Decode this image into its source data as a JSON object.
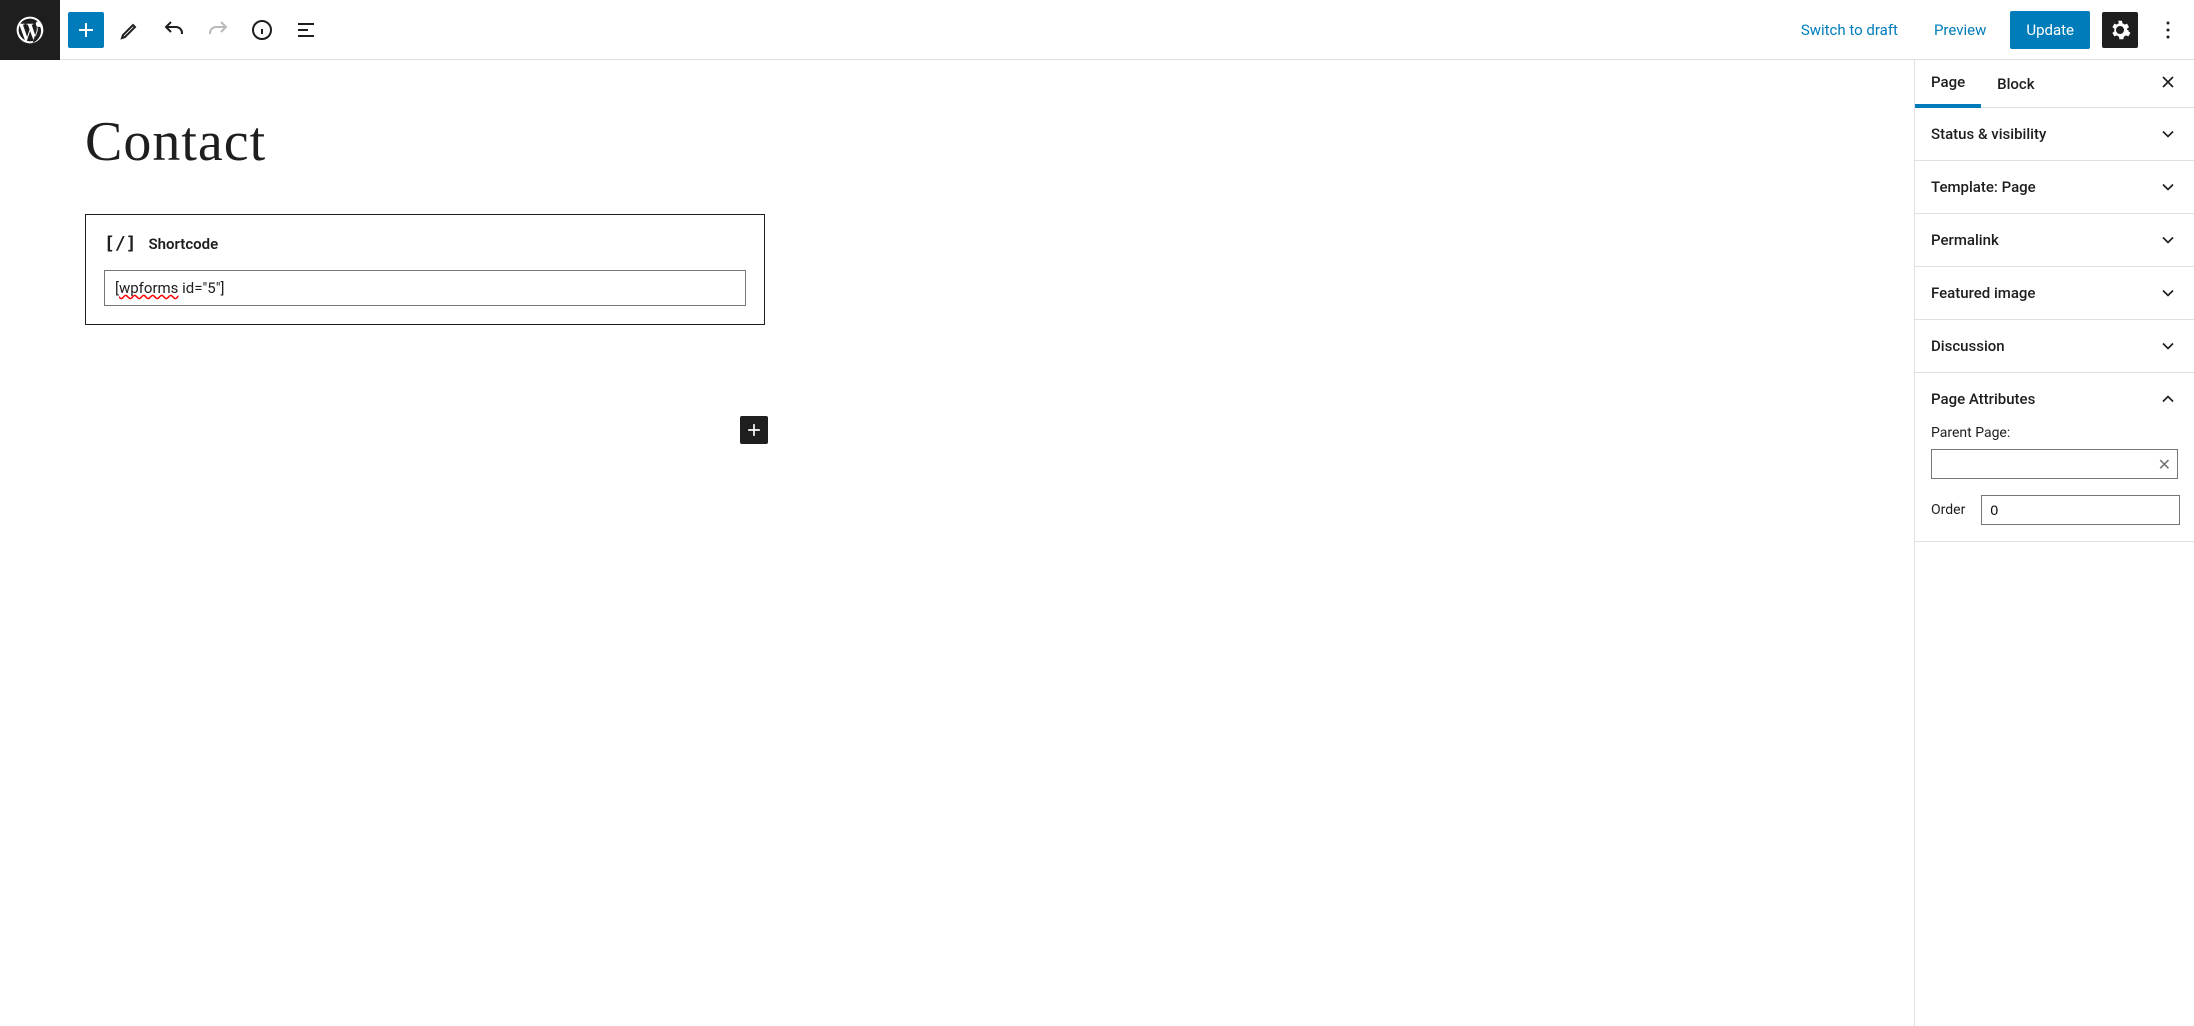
{
  "toolbar": {
    "switch_to_draft": "Switch to draft",
    "preview": "Preview",
    "update": "Update"
  },
  "page": {
    "title": "Contact"
  },
  "shortcode": {
    "label": "Shortcode",
    "value_part1": "[",
    "value_underlined": "wpforms",
    "value_part2": " id=\"5\"]"
  },
  "sidebar": {
    "tabs": {
      "page": "Page",
      "block": "Block"
    },
    "panels": {
      "status": "Status & visibility",
      "template": "Template: Page",
      "permalink": "Permalink",
      "featured": "Featured image",
      "discussion": "Discussion",
      "attributes": "Page Attributes"
    },
    "attributes": {
      "parent_label": "Parent Page:",
      "order_label": "Order",
      "order_value": "0"
    }
  }
}
